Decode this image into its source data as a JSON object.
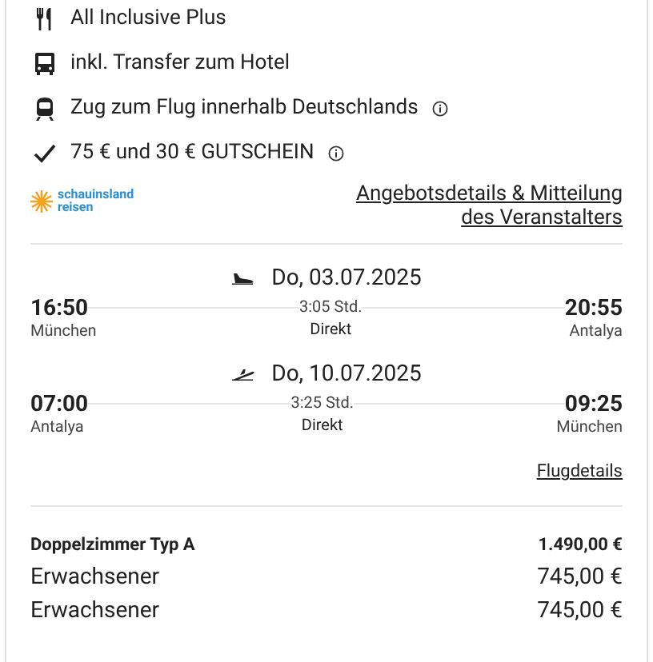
{
  "features": [
    {
      "label": "All Inclusive Plus",
      "info": false
    },
    {
      "label": "inkl. Transfer zum Hotel",
      "info": false
    },
    {
      "label": "Zug zum Flug innerhalb Deutschlands",
      "info": true
    },
    {
      "label": "75 € und 30 € GUTSCHEIN",
      "info": true
    }
  ],
  "operator": {
    "logo_line_1": "schauinsland",
    "logo_line_2": "reisen",
    "link": "Angebotsdetails & Mitteilung des Veranstalters"
  },
  "flights": [
    {
      "kind": "outbound",
      "date": "Do, 03.07.2025",
      "depart_time": "16:50",
      "depart_city": "München",
      "duration": "3:05 Std.",
      "stops": "Direkt",
      "arrive_time": "20:55",
      "arrive_city": "Antalya"
    },
    {
      "kind": "return",
      "date": "Do, 10.07.2025",
      "depart_time": "07:00",
      "depart_city": "Antalya",
      "duration": "3:25 Std.",
      "stops": "Direkt",
      "arrive_time": "09:25",
      "arrive_city": "München"
    }
  ],
  "flight_details_link": "Flugdetails",
  "prices": [
    {
      "kind": "total",
      "label": "Doppelzimmer Typ A",
      "amount": "1.490,00 €"
    },
    {
      "kind": "person",
      "label": "Erwachsener",
      "amount": "745,00 €"
    },
    {
      "kind": "person",
      "label": "Erwachsener",
      "amount": "745,00 €"
    }
  ]
}
